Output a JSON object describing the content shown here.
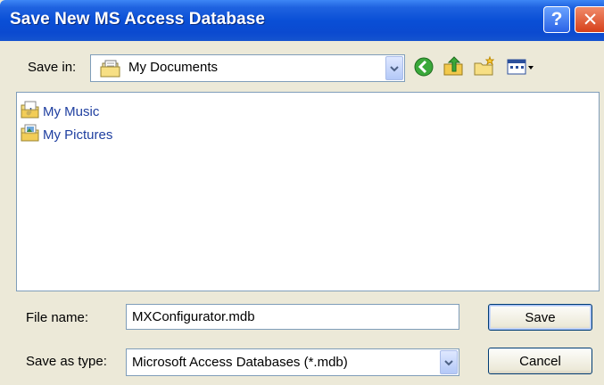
{
  "dialog": {
    "title": "Save New MS Access Database",
    "help_glyph": "?",
    "close_glyph": "✕"
  },
  "save_in": {
    "label": "Save in:",
    "value": "My Documents",
    "icon": "my-documents-icon"
  },
  "toolbar": {
    "items": [
      {
        "name": "back-button",
        "icon": "back-arrow-icon"
      },
      {
        "name": "up-folder-button",
        "icon": "up-folder-icon"
      },
      {
        "name": "new-folder-button",
        "icon": "new-folder-icon"
      },
      {
        "name": "views-menu-button",
        "icon": "views-icon"
      }
    ]
  },
  "files": [
    {
      "name": "My Music",
      "icon": "music-folder-icon"
    },
    {
      "name": "My Pictures",
      "icon": "pictures-folder-icon"
    }
  ],
  "file_name": {
    "label": "File name:",
    "value": "MXConfigurator.mdb"
  },
  "save_as_type": {
    "label": "Save as type:",
    "value": "Microsoft Access Databases (*.mdb)"
  },
  "buttons": {
    "save": "Save",
    "cancel": "Cancel"
  },
  "colors": {
    "title_bar": "#0a4fd6",
    "dialog_bg": "#ece9d8",
    "input_border": "#7f9db9",
    "link_text": "#1f3fa0"
  }
}
